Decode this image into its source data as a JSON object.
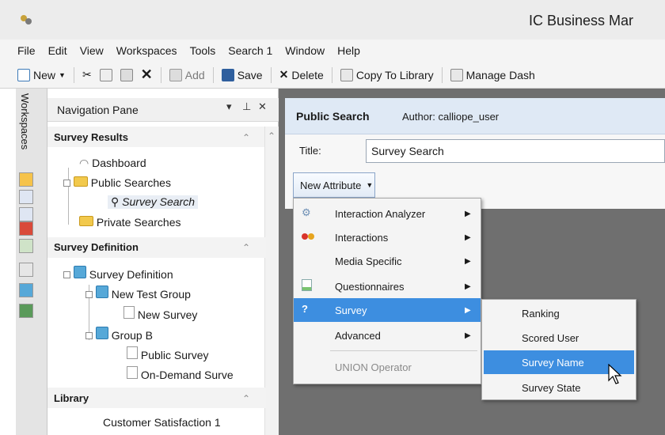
{
  "window": {
    "title": "IC Business Mar"
  },
  "menubar": {
    "items": [
      "File",
      "Edit",
      "View",
      "Workspaces",
      "Tools",
      "Search 1",
      "Window",
      "Help"
    ]
  },
  "toolbar": {
    "new_label": "New",
    "add_label": "Add",
    "save_label": "Save",
    "delete_label": "Delete",
    "copy_label": "Copy To Library",
    "manage_label": "Manage Dash"
  },
  "workspaces": {
    "label": "Workspaces"
  },
  "nav": {
    "title": "Navigation Pane",
    "pin": "▾ ⊥ ✕",
    "sections": {
      "survey_results": "Survey Results",
      "survey_definition": "Survey Definition",
      "library": "Library"
    },
    "results_items": {
      "dashboard": "Dashboard",
      "public_searches": "Public Searches",
      "survey_search": "Survey Search",
      "private_searches": "Private Searches"
    },
    "definition_items": {
      "survey_definition": "Survey Definition",
      "new_test_group": "New Test Group",
      "new_survey": "New Survey",
      "group_b": "Group B",
      "public_survey": "Public Survey",
      "on_demand": "On-Demand Surve"
    },
    "library_items": {
      "customer_sat": "Customer Satisfaction 1"
    }
  },
  "panel": {
    "title": "Public Search",
    "author": "Author: calliope_user",
    "title_label": "Title:",
    "title_value": "Survey Search",
    "new_attribute": "New Attribute"
  },
  "menu1": {
    "items": [
      "Interaction Analyzer",
      "Interactions",
      "Media Specific",
      "Questionnaires",
      "Survey",
      "Advanced"
    ],
    "union": "UNION Operator"
  },
  "menu2": {
    "items": [
      "Ranking",
      "Scored User",
      "Survey Name",
      "Survey State"
    ]
  },
  "colors": {
    "highlight": "#3d8ee0",
    "header": "#dfe9f5",
    "main_bg": "#6f6f6f"
  }
}
